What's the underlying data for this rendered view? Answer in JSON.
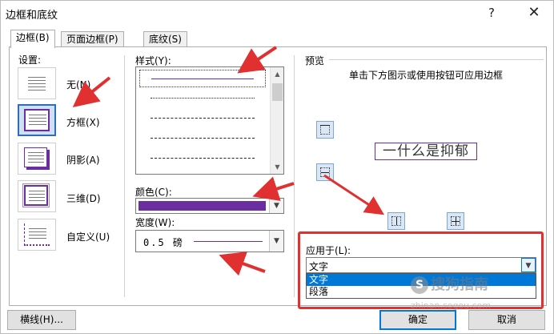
{
  "window": {
    "title": "边框和底纹",
    "help_label": "?",
    "close_label": "✕"
  },
  "tabs": [
    {
      "label": "边框(B)",
      "active": true
    },
    {
      "label": "页面边框(P)",
      "active": false
    },
    {
      "label": "底纹(S)",
      "active": false
    }
  ],
  "settings": {
    "heading": "设置:",
    "items": [
      {
        "label": "无(N)",
        "icon": "no-border-thumbnail"
      },
      {
        "label": "方框(X)",
        "icon": "box-border-thumbnail",
        "selected": true
      },
      {
        "label": "阴影(A)",
        "icon": "shadow-border-thumbnail"
      },
      {
        "label": "三维(D)",
        "icon": "3d-border-thumbnail"
      },
      {
        "label": "自定义(U)",
        "icon": "custom-border-thumbnail"
      }
    ]
  },
  "style": {
    "heading": "样式(Y):",
    "color_label": "颜色(C):",
    "color_value": "#6a2ea0",
    "width_label": "宽度(W):",
    "width_value": "0.5 磅"
  },
  "preview": {
    "heading": "预览",
    "instruction": "单击下方图示或使用按钮可应用边框",
    "sample_text": "一什么是抑郁"
  },
  "apply_to": {
    "label": "应用于(L):",
    "selected": "文字",
    "options": [
      "文字",
      "段落"
    ]
  },
  "buttons": {
    "horizontal_line": "横线(H)...",
    "ok": "确定",
    "cancel": "取消"
  },
  "watermark": {
    "brand": "搜狗指南",
    "url": "zhinan.sogou.com"
  },
  "colors": {
    "accent": "#0078d7",
    "border_purple": "#6a2ea0",
    "annotation_red": "#e03030"
  }
}
